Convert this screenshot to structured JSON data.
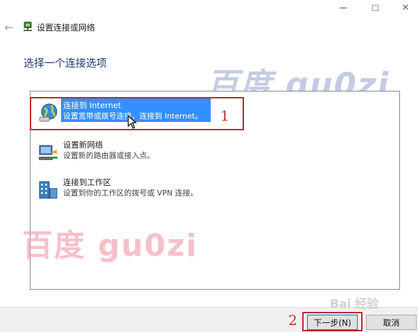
{
  "window": {
    "title": "设置连接或网络",
    "min_icon": "minimize-icon",
    "max_icon": "maximize-icon",
    "close_icon": "close-icon",
    "close_glyph": "✕"
  },
  "header": {
    "back_icon": "back-arrow-icon",
    "back_glyph": "←",
    "heading": "选择一个连接选项"
  },
  "options": [
    {
      "title": "连接到 Internet",
      "desc": "设置宽带或拨号连接，连接到 Internet。",
      "icon": "globe-icon",
      "selected": true
    },
    {
      "title": "设置新网络",
      "desc": "设置新的路由器或接入点。",
      "icon": "network-setup-icon",
      "selected": false
    },
    {
      "title": "连接到工作区",
      "desc": "设置到你的工作区的拨号或 VPN 连接。",
      "icon": "workplace-icon",
      "selected": false
    }
  ],
  "annotations": {
    "one": "1",
    "two": "2",
    "color": "#c0262c"
  },
  "watermarks": {
    "blue": "百度 gu0zi",
    "red": "百度 gu0zi",
    "baidu": "Bai 经验"
  },
  "buttons": {
    "next": "下一步(N)",
    "cancel": "取消"
  },
  "colors": {
    "selection": "#3390ff",
    "heading": "#1e3a6e",
    "annotation": "#c0262c"
  }
}
